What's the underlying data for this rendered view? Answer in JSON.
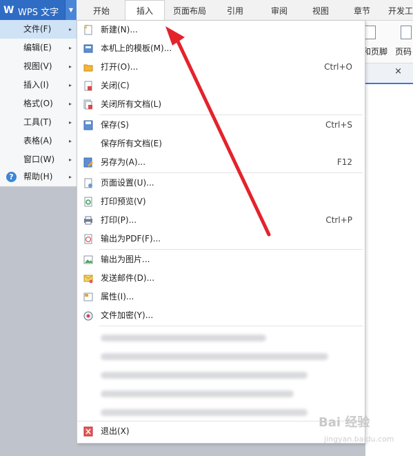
{
  "app": {
    "logo": "W",
    "title": "WPS 文字",
    "dropdown_arrow": "▼"
  },
  "tabs": [
    "开始",
    "插入",
    "页面布局",
    "引用",
    "审阅",
    "视图",
    "章节",
    "开发工"
  ],
  "active_tab": "插入",
  "ribbon": {
    "header_footer_label": "和页脚",
    "page_number_label": "页码"
  },
  "doc_close": "×",
  "left_menu": {
    "items": [
      {
        "label": "文件(F)",
        "arrow": "▸",
        "highlighted": true
      },
      {
        "label": "编辑(E)",
        "arrow": "▸"
      },
      {
        "label": "视图(V)",
        "arrow": "▸"
      },
      {
        "label": "插入(I)",
        "arrow": "▸"
      },
      {
        "label": "格式(O)",
        "arrow": "▸"
      },
      {
        "label": "工具(T)",
        "arrow": "▸"
      },
      {
        "label": "表格(A)",
        "arrow": "▸"
      },
      {
        "label": "窗口(W)",
        "arrow": "▸"
      },
      {
        "label": "帮助(H)",
        "arrow": "▸",
        "icon": "help-icon",
        "icon_glyph": "?"
      }
    ]
  },
  "file_menu": {
    "items": [
      {
        "label": "新建(N)...",
        "shortcut": "",
        "icon": "new-doc-icon"
      },
      {
        "label": "本机上的模板(M)...",
        "shortcut": "",
        "icon": "template-icon"
      },
      {
        "label": "打开(O)...",
        "shortcut": "Ctrl+O",
        "icon": "folder-open-icon"
      },
      {
        "label": "关闭(C)",
        "shortcut": "",
        "icon": "close-doc-icon"
      },
      {
        "label": "关闭所有文档(L)",
        "shortcut": "",
        "icon": "close-all-icon"
      },
      {
        "label": "保存(S)",
        "shortcut": "Ctrl+S",
        "icon": "save-icon"
      },
      {
        "label": "保存所有文档(E)",
        "shortcut": "",
        "icon": ""
      },
      {
        "label": "另存为(A)...",
        "shortcut": "F12",
        "icon": "save-as-icon"
      },
      {
        "label": "页面设置(U)...",
        "shortcut": "",
        "icon": "page-setup-icon"
      },
      {
        "label": "打印预览(V)",
        "shortcut": "",
        "icon": "print-preview-icon"
      },
      {
        "label": "打印(P)...",
        "shortcut": "Ctrl+P",
        "icon": "printer-icon"
      },
      {
        "label": "输出为PDF(F)...",
        "shortcut": "",
        "icon": "pdf-icon"
      },
      {
        "label": "输出为图片...",
        "shortcut": "",
        "icon": "image-export-icon"
      },
      {
        "label": "发送邮件(D)...",
        "shortcut": "",
        "icon": "mail-icon"
      },
      {
        "label": "属性(I)...",
        "shortcut": "",
        "icon": "properties-icon"
      },
      {
        "label": "文件加密(Y)...",
        "shortcut": "",
        "icon": "encrypt-icon"
      },
      {
        "label": "退出(X)",
        "shortcut": "",
        "icon": "exit-icon"
      }
    ],
    "recent_files_blurred": 5
  },
  "watermark": {
    "main": "Bai 经验",
    "sub": "jingyan.baidu.com"
  },
  "colors": {
    "app_blue": "#2f6cc4",
    "highlight": "#cfe2f6",
    "arrow_red": "#e3232c"
  }
}
